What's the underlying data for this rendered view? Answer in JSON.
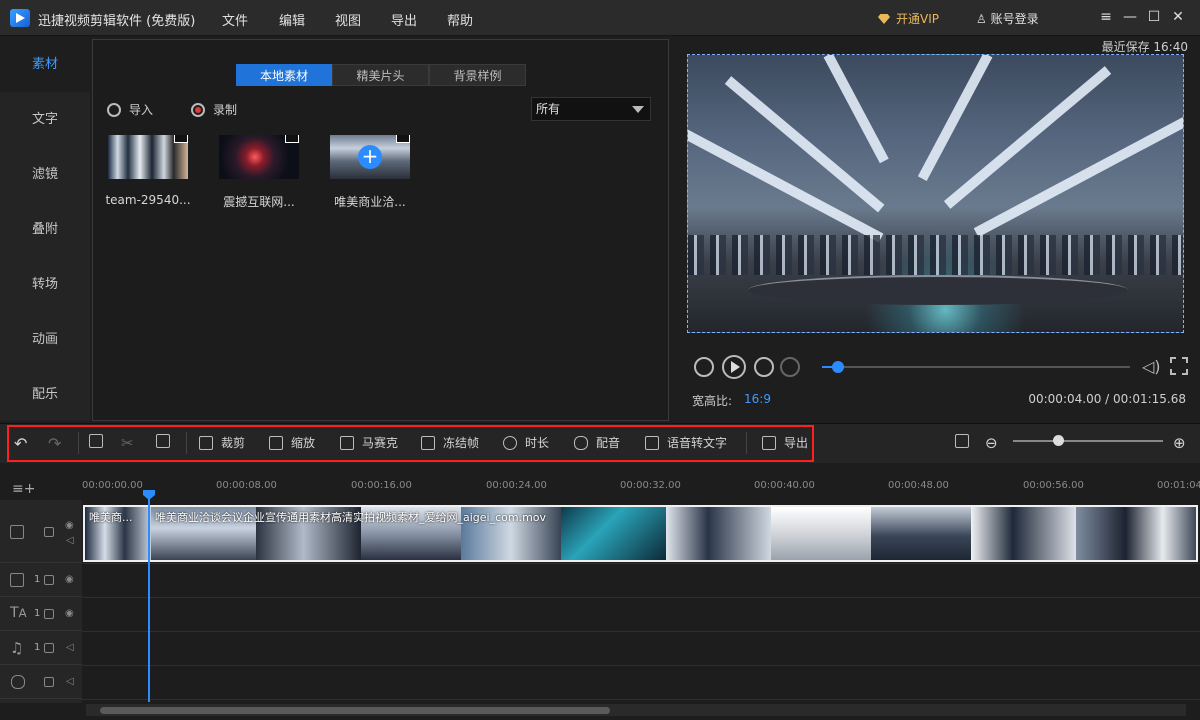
{
  "app": {
    "title": "迅捷视频剪辑软件 (免费版)"
  },
  "menu": [
    "文件",
    "编辑",
    "视图",
    "导出",
    "帮助"
  ],
  "header": {
    "vip": "开通VIP",
    "account": "账号登录"
  },
  "window_controls": [
    "≡",
    "—",
    "☐",
    "✕"
  ],
  "sidebar": {
    "items": [
      "素材",
      "文字",
      "滤镜",
      "叠附",
      "转场",
      "动画",
      "配乐"
    ],
    "active": "素材"
  },
  "media": {
    "tabs": [
      "本地素材",
      "精美片头",
      "背景样例"
    ],
    "import_label": "导入",
    "record_label": "录制",
    "filter_value": "所有",
    "clips": [
      {
        "name": "team-29540..."
      },
      {
        "name": "震撼互联网..."
      },
      {
        "name": "唯美商业洽..."
      }
    ]
  },
  "preview": {
    "autosave": "最近保存 16:40",
    "aspect_label": "宽高比:",
    "aspect_value": "16:9",
    "timecode": "00:00:04.00 / 00:01:15.68",
    "progress": 0.053
  },
  "toolbar": {
    "crop": "裁剪",
    "zoom": "缩放",
    "mosaic": "马赛克",
    "freeze": "冻结帧",
    "duration": "时长",
    "dub": "配音",
    "speech_to_text": "语音转文字",
    "export": "导出",
    "timeline_zoom": 0.3
  },
  "timeline": {
    "ticks": [
      "00:00:00.00",
      "00:00:08.00",
      "00:00:16.00",
      "00:00:24.00",
      "00:00:32.00",
      "00:00:40.00",
      "00:00:48.00",
      "00:00:56.00",
      "00:01:04"
    ],
    "clip1_label": "唯美商...",
    "clip2_label": "唯美商业洽谈会议企业宣传通用素材高清实拍视频素材_爱给网_aigei_com.mov",
    "track_counts": [
      "1",
      "1",
      "1"
    ]
  },
  "colors": {
    "accent": "#2b8cff",
    "highlight_box": "#ff1f1f",
    "vip": "#e8b85a"
  }
}
